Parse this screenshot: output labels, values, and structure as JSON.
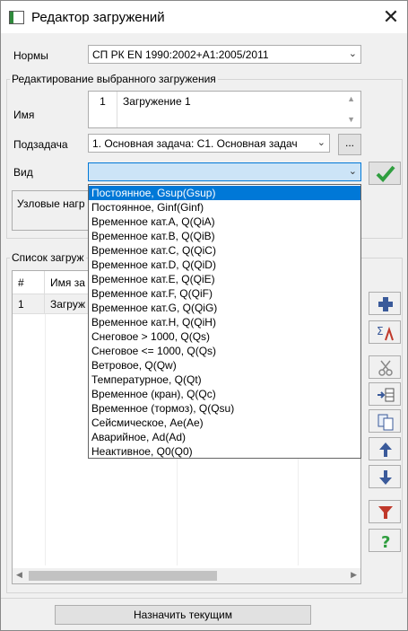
{
  "window": {
    "title": "Редактор загружений",
    "close": "✕"
  },
  "norms": {
    "label": "Нормы",
    "value": "СП РК EN 1990:2002+A1:2005/2011"
  },
  "edit_group": {
    "title": "Редактирование выбранного загружения"
  },
  "name": {
    "label": "Имя",
    "number": "1",
    "value": "Загружение 1"
  },
  "subtask": {
    "label": "Подзадача",
    "value": "1. Основная задача: С1. Основная задач",
    "more": "..."
  },
  "kind": {
    "label": "Вид",
    "value": ""
  },
  "nodal": {
    "label": "Узловые нагр"
  },
  "list_group": {
    "title": "Список загруж"
  },
  "table": {
    "headers": [
      "#",
      "Имя за"
    ],
    "rows": [
      {
        "num": "1",
        "name": "Загруж"
      }
    ]
  },
  "dropdown_options": [
    "Постоянное, Gsup(Gsup)",
    "Постоянное, Ginf(Ginf)",
    "Временное кат.А, Q(QiA)",
    "Временное кат.В, Q(QiB)",
    "Временное кат.С, Q(QiC)",
    "Временное кат.D, Q(QiD)",
    "Временное кат.Е, Q(QiE)",
    "Временное кат.F, Q(QiF)",
    "Временное кат.G, Q(QiG)",
    "Временное кат.Н, Q(QiH)",
    "Снеговое > 1000, Q(Qs)",
    "Снеговое <= 1000, Q(Qs)",
    "Ветровое, Q(Qw)",
    "Температурное, Q(Qt)",
    "Временное (кран), Q(Qc)",
    "Временное (тормоз), Q(Qsu)",
    "Сейсмическое, Ae(Ae)",
    "Аварийное, Ad(Ad)",
    "Неактивное, Q0(Q0)"
  ],
  "selected_option": "Постоянное, Gsup(Gsup)",
  "footer": {
    "assign_label": "Назначить текущим"
  },
  "colors": {
    "accent": "#0078d7",
    "ok_green": "#2f9e3f",
    "add_blue": "#3a5a9a",
    "filter_red": "#c0392b"
  }
}
